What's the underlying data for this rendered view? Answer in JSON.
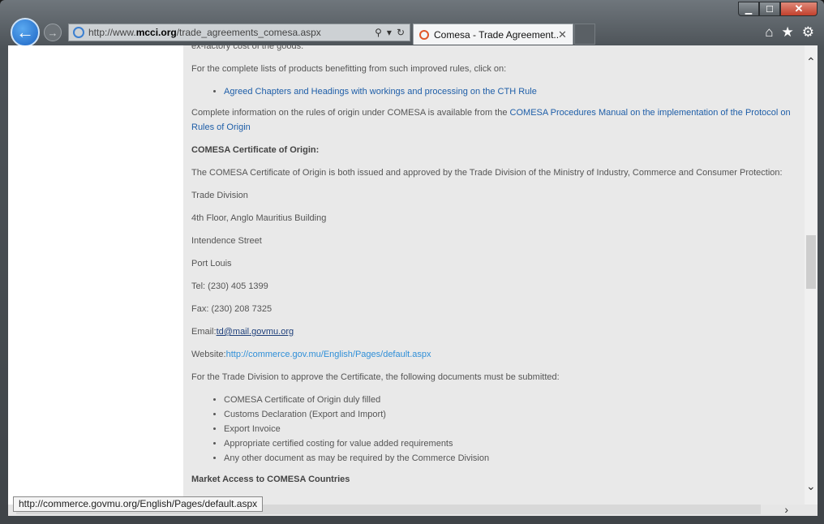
{
  "browser": {
    "url_prefix": "http://www.",
    "url_domain": "mcci.org",
    "url_path": "/trade_agreements_comesa.aspx",
    "tab_title": "Comesa - Trade Agreement...",
    "status_url": "http://commerce.govmu.org/English/Pages/default.aspx"
  },
  "content": {
    "line_top": "ex-factory cost of the goods.",
    "complete_lists_intro": "For the complete lists of products benefitting from such improved rules, click on:",
    "cth_link": "Agreed Chapters and Headings with workings and processing on the CTH Rule",
    "complete_info_text": "Complete information on the rules of origin under COMESA is available from the ",
    "manual_link": "COMESA Procedures Manual on the implementation of the Protocol on Rules of Origin",
    "cert_heading": "COMESA Certificate of Origin:",
    "cert_text": "The COMESA Certificate of Origin is both issued and approved by the Trade Division of the Ministry of Industry, Commerce and Consumer Protection:",
    "address": [
      "Trade Division",
      "4th Floor, Anglo Mauritius Building",
      "Intendence Street",
      "Port Louis"
    ],
    "tel": "Tel: (230) 405 1399",
    "fax": "Fax: (230) 208 7325",
    "email_label": "Email:",
    "email_link": "td@mail.govmu.org",
    "website_label": "Website:",
    "website_link": "http://commerce.gov.mu/English/Pages/default.aspx",
    "docs_intro": "For the Trade Division to approve the Certificate, the following documents must be submitted:",
    "docs": [
      "COMESA Certificate of Origin duly filled",
      "Customs Declaration (Export and Import)",
      "Export Invoice",
      "Appropriate certified costing for value added requirements",
      "Any other document as may be required by the Commerce Division"
    ],
    "market_heading": "Market Access to COMESA Countries"
  }
}
